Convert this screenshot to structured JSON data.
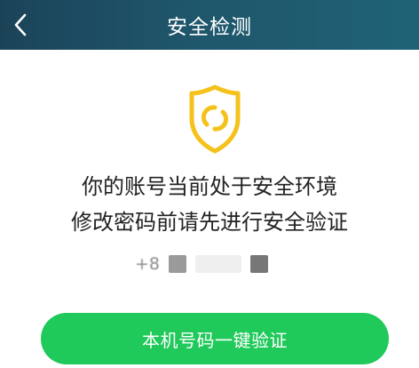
{
  "nav": {
    "title": "安全检测"
  },
  "icons": {
    "back": "chevron-left-icon",
    "shield": "shield-icon",
    "accent": "#f5c21b"
  },
  "message": {
    "line1": "你的账号当前处于安全环境",
    "line2": "修改密码前请先进行安全验证"
  },
  "phone": {
    "visible_prefix": "+8"
  },
  "button": {
    "label": "本机号码一键验证",
    "color": "#1fc95a"
  }
}
